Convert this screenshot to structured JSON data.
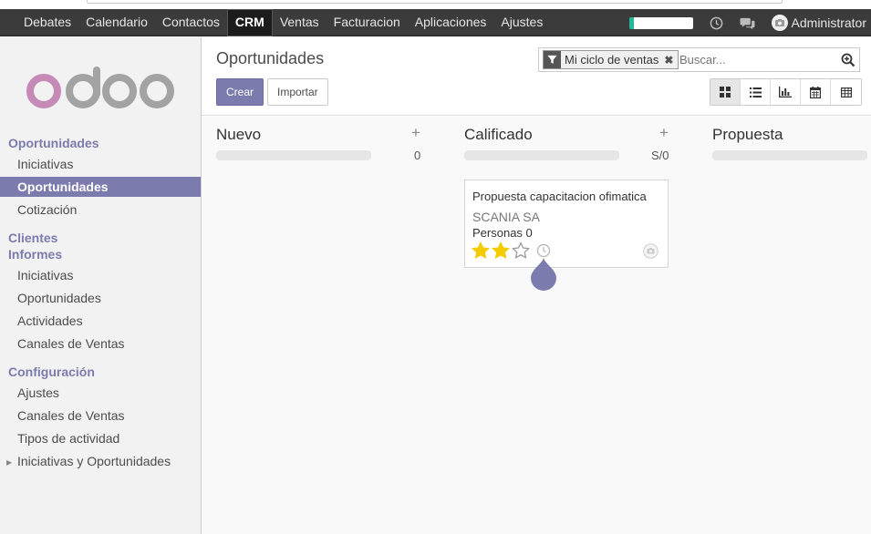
{
  "topnav": {
    "menu": [
      "Debates",
      "Calendario",
      "Contactos",
      "CRM",
      "Ventas",
      "Facturacion",
      "Aplicaciones",
      "Ajustes"
    ],
    "active": "CRM",
    "progress_fraction": 0.08,
    "user": "Administrator",
    "progress_color": "#21b799"
  },
  "sidebar": {
    "logo_text": "odoo",
    "sections": [
      {
        "title": "Oportunidades",
        "items": [
          "Iniciativas",
          "Oportunidades",
          "Cotización"
        ]
      },
      {
        "title": "Clientes",
        "items": []
      },
      {
        "title": "Informes",
        "items": [
          "Iniciativas",
          "Oportunidades",
          "Actividades",
          "Canales de Ventas"
        ]
      },
      {
        "title": "Configuración",
        "items": [
          "Ajustes",
          "Canales de Ventas",
          "Tipos de actividad",
          "Iniciativas y Oportunidades"
        ]
      }
    ],
    "active_item": "Oportunidades"
  },
  "control": {
    "title": "Oportunidades",
    "create_label": "Crear",
    "import_label": "Importar",
    "search": {
      "facet": "Mi ciclo de ventas",
      "placeholder": "Buscar..."
    },
    "views": [
      "kanban-icon",
      "list-icon",
      "graph-icon",
      "calendar-icon",
      "pivot-icon"
    ],
    "active_view": "kanban-icon"
  },
  "kanban": {
    "columns": [
      {
        "name": "Nuevo",
        "total": "0"
      },
      {
        "name": "Calificado",
        "total": "S/0"
      },
      {
        "name": "Propuesta",
        "total": ""
      }
    ],
    "card": {
      "title": "Propuesta capacitacion ofimatica",
      "partner": "SCANIA SA",
      "persons": "Personas 0",
      "priority": 2,
      "priority_max": 3
    }
  },
  "colors": {
    "brand": "#7c7bad",
    "nav_bg": "#3b3b3b",
    "star": "#f3cc00"
  }
}
